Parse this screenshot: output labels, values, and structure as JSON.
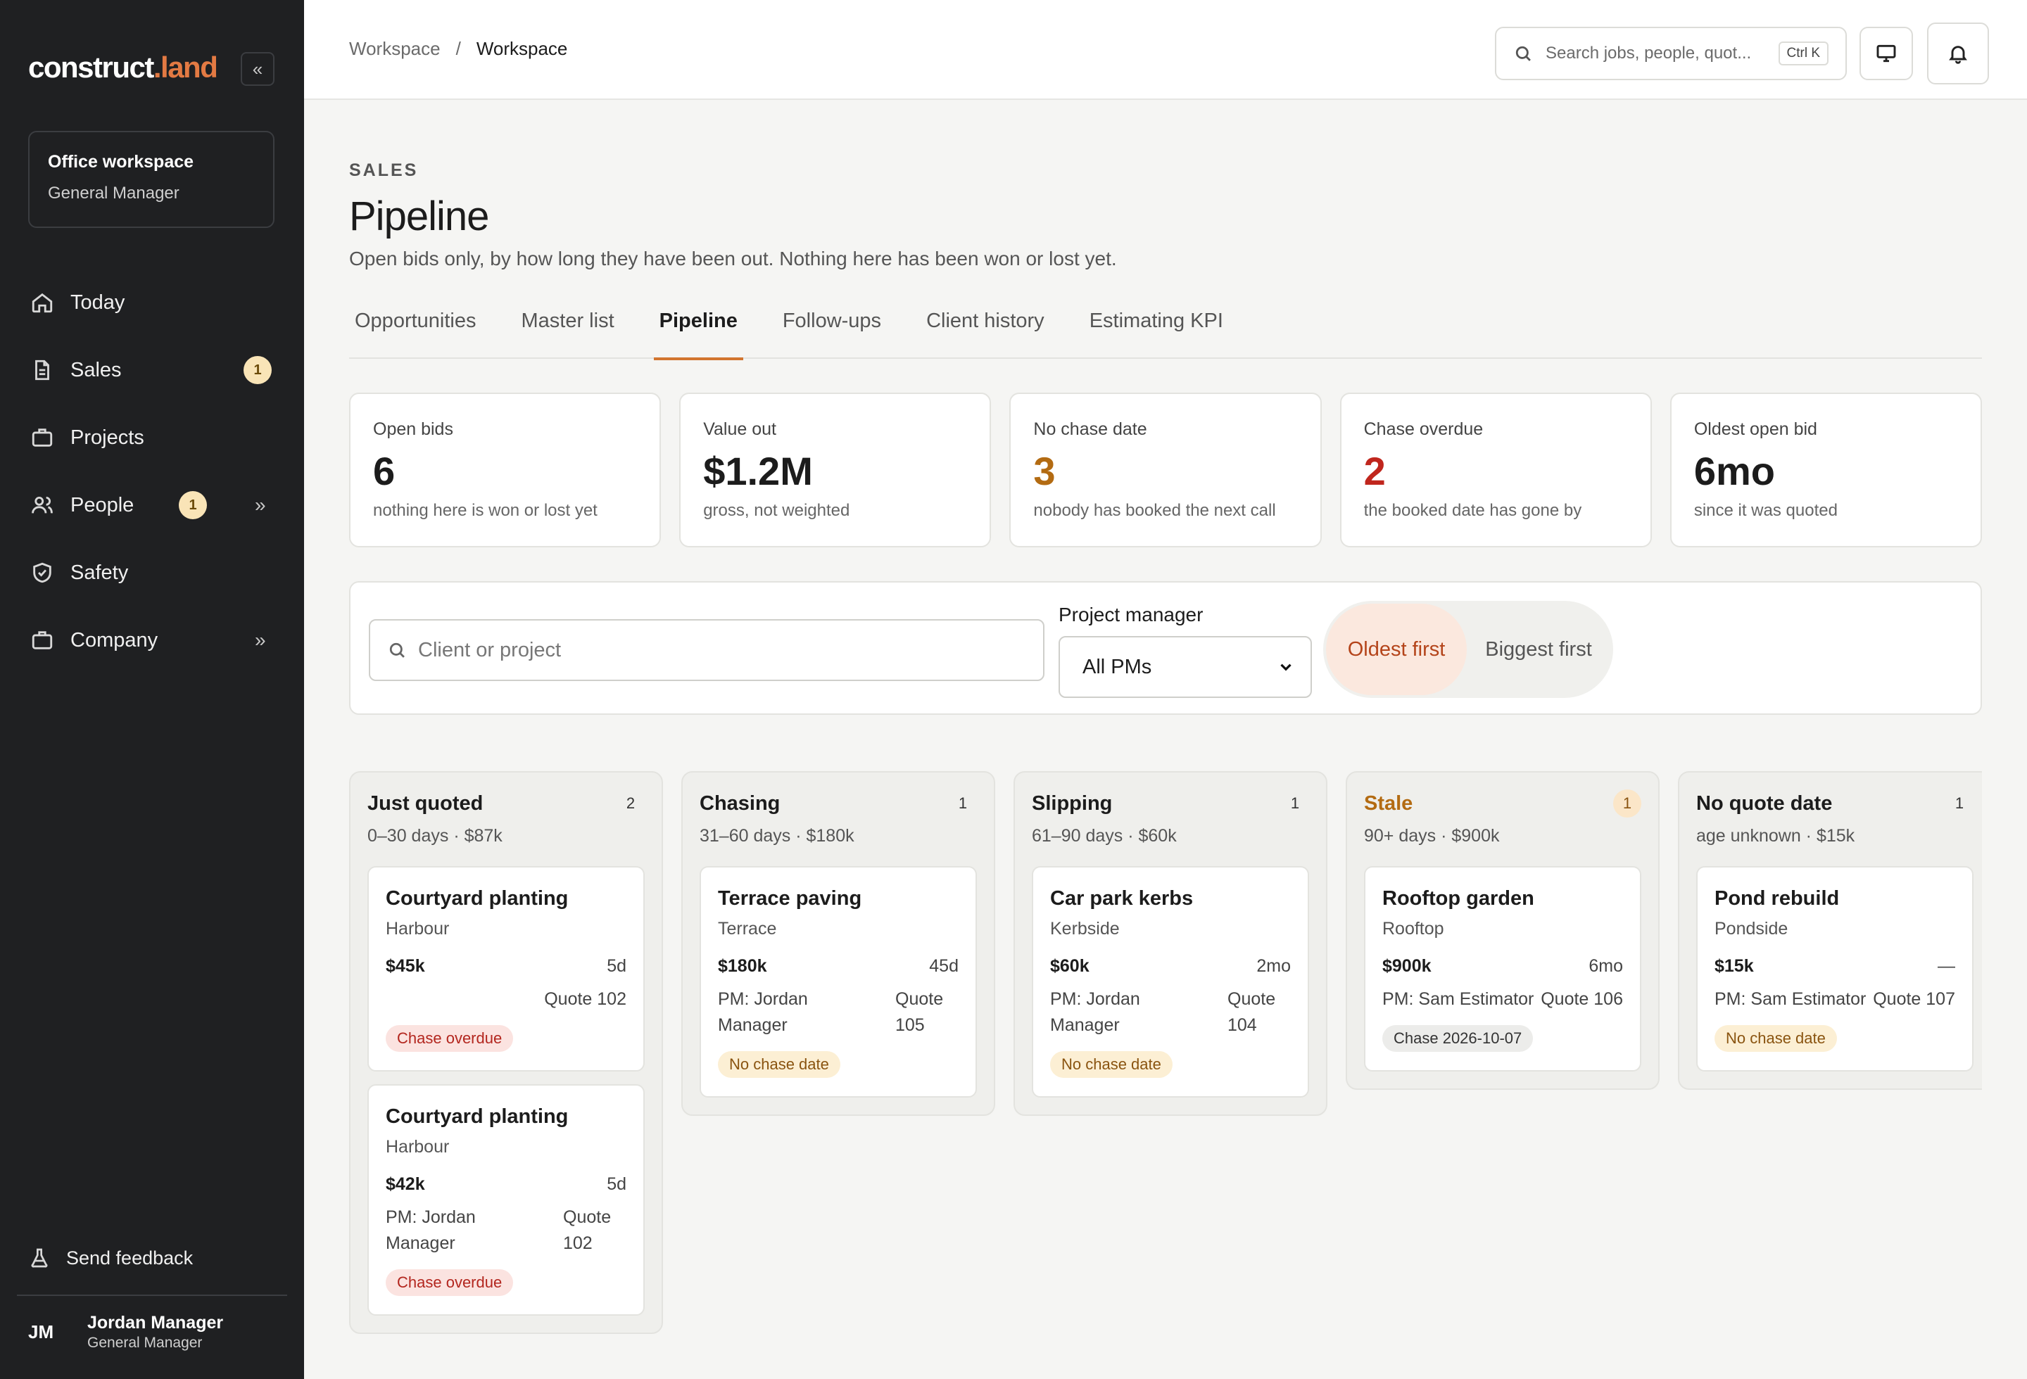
{
  "brand": {
    "name_main": "construct",
    "name_accent": ".land"
  },
  "sidebar": {
    "collapse_glyph": "«",
    "workspace": {
      "name": "Office workspace",
      "role": "General Manager"
    },
    "items": [
      {
        "label": "Today",
        "icon": "home-icon"
      },
      {
        "label": "Sales",
        "icon": "document-icon",
        "badge": "1"
      },
      {
        "label": "Projects",
        "icon": "briefcase-icon"
      },
      {
        "label": "People",
        "icon": "people-icon",
        "badge": "1",
        "chevron": "»"
      },
      {
        "label": "Safety",
        "icon": "shield-icon"
      },
      {
        "label": "Company",
        "icon": "briefcase-icon",
        "chevron": "»"
      }
    ],
    "feedback": "Send feedback",
    "user": {
      "initials": "JM",
      "name": "Jordan Manager",
      "role": "General Manager"
    }
  },
  "topbar": {
    "breadcrumb": [
      "Workspace",
      "Workspace"
    ],
    "breadcrumb_sep": "/",
    "search_placeholder": "Search jobs, people, quot...",
    "search_shortcut": "Ctrl K"
  },
  "page": {
    "eyebrow": "SALES",
    "title": "Pipeline",
    "subtitle": "Open bids only, by how long they have been out. Nothing here has been won or lost yet."
  },
  "tabs": [
    {
      "label": "Opportunities",
      "active": false
    },
    {
      "label": "Master list",
      "active": false
    },
    {
      "label": "Pipeline",
      "active": true
    },
    {
      "label": "Follow-ups",
      "active": false
    },
    {
      "label": "Client history",
      "active": false
    },
    {
      "label": "Estimating KPI",
      "active": false
    }
  ],
  "stats": [
    {
      "label": "Open bids",
      "value": "6",
      "note": "nothing here is won or lost yet",
      "tone": "default"
    },
    {
      "label": "Value out",
      "value": "$1.2M",
      "note": "gross, not weighted",
      "tone": "default"
    },
    {
      "label": "No chase date",
      "value": "3",
      "note": "nobody has booked the next call",
      "tone": "warn"
    },
    {
      "label": "Chase overdue",
      "value": "2",
      "note": "the booked date has gone by",
      "tone": "danger"
    },
    {
      "label": "Oldest open bid",
      "value": "6mo",
      "note": "since it was quoted",
      "tone": "default"
    }
  ],
  "filters": {
    "search_placeholder": "Client or project",
    "pm_label": "Project manager",
    "pm_selected": "All PMs",
    "sort_options": [
      "Oldest first",
      "Biggest first"
    ],
    "sort_active": "Oldest first"
  },
  "columns": [
    {
      "title": "Just quoted",
      "count": "2",
      "sub": "0–30 days · $87k",
      "tone": "default",
      "cards": [
        {
          "title": "Courtyard planting",
          "client": "Harbour",
          "value": "$45k",
          "age": "5d",
          "pm": "",
          "quote": "Quote 102",
          "tag": "Chase overdue",
          "tag_tone": "danger"
        },
        {
          "title": "Courtyard planting",
          "client": "Harbour",
          "value": "$42k",
          "age": "5d",
          "pm": "PM: Jordan Manager",
          "quote": "Quote 102",
          "tag": "Chase overdue",
          "tag_tone": "danger"
        }
      ]
    },
    {
      "title": "Chasing",
      "count": "1",
      "sub": "31–60 days · $180k",
      "tone": "default",
      "cards": [
        {
          "title": "Terrace paving",
          "client": "Terrace",
          "value": "$180k",
          "age": "45d",
          "pm": "PM: Jordan Manager",
          "quote": "Quote 105",
          "tag": "No chase date",
          "tag_tone": "warn"
        }
      ]
    },
    {
      "title": "Slipping",
      "count": "1",
      "sub": "61–90 days · $60k",
      "tone": "default",
      "cards": [
        {
          "title": "Car park kerbs",
          "client": "Kerbside",
          "value": "$60k",
          "age": "2mo",
          "pm": "PM: Jordan Manager",
          "quote": "Quote 104",
          "tag": "No chase date",
          "tag_tone": "warn"
        }
      ]
    },
    {
      "title": "Stale",
      "count": "1",
      "sub": "90+ days · $900k",
      "tone": "stale",
      "cards": [
        {
          "title": "Rooftop garden",
          "client": "Rooftop",
          "value": "$900k",
          "age": "6mo",
          "pm": "PM: Sam Estimator",
          "quote": "Quote 106",
          "tag": "Chase 2026-10-07",
          "tag_tone": "neutral"
        }
      ]
    },
    {
      "title": "No quote date",
      "count": "1",
      "sub": "age unknown · $15k",
      "tone": "default",
      "cards": [
        {
          "title": "Pond rebuild",
          "client": "Pondside",
          "value": "$15k",
          "age": "—",
          "pm": "PM: Sam Estimator",
          "quote": "Quote 107",
          "tag": "No chase date",
          "tag_tone": "warn"
        }
      ]
    }
  ],
  "colors": {
    "accent": "#d2752f",
    "sidebar_bg": "#1f2022",
    "warn": "#b36b12",
    "danger": "#c0261d"
  }
}
